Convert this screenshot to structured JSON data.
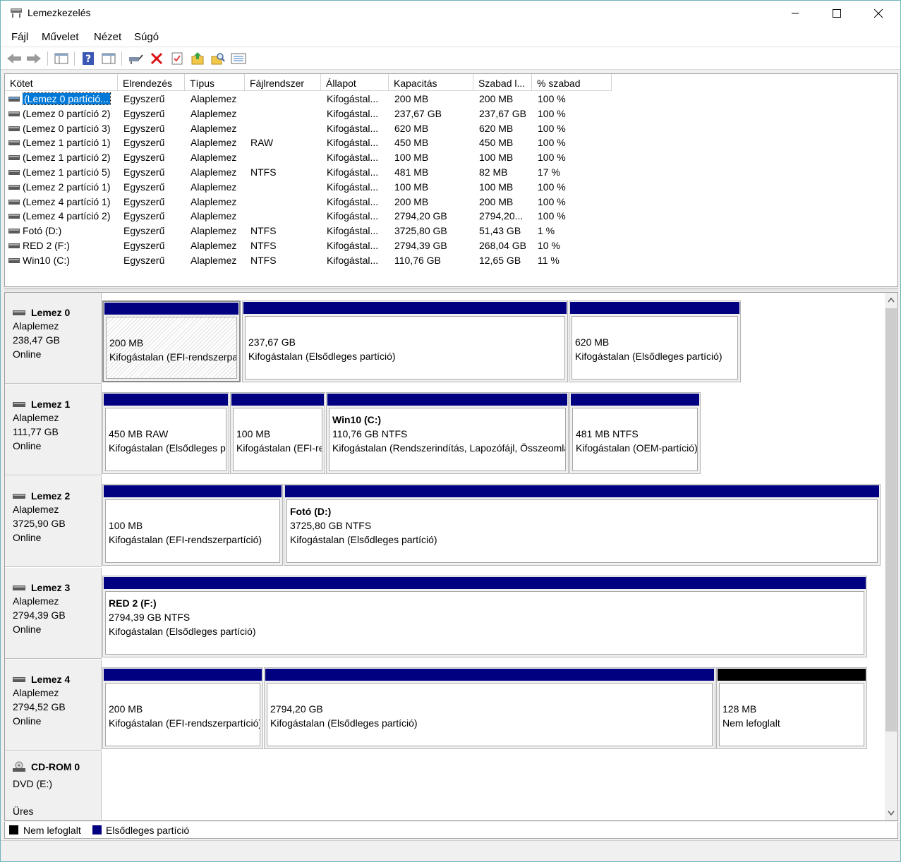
{
  "window": {
    "title": "Lemezkezelés"
  },
  "menu": [
    "Fájl",
    "Művelet",
    "Nézet",
    "Súgó"
  ],
  "toolbar": [
    "back-icon",
    "forward-icon",
    "console-tree-icon",
    "help-icon",
    "properties-view-icon",
    "connect-icon",
    "delete-icon",
    "check-icon",
    "folder-up-icon",
    "search-icon",
    "list-view-icon"
  ],
  "list": {
    "columns": [
      "Kötet",
      "Elrendezés",
      "Típus",
      "Fájlrendszer",
      "Állapot",
      "Kapacitás",
      "Szabad l...",
      "% szabad"
    ],
    "rows": [
      [
        "(Lemez 0 partíció...",
        "Egyszerű",
        "Alaplemez",
        "",
        "Kifogástal...",
        "200 MB",
        "200 MB",
        "100 %"
      ],
      [
        "(Lemez 0 partíció 2)",
        "Egyszerű",
        "Alaplemez",
        "",
        "Kifogástal...",
        "237,67 GB",
        "237,67 GB",
        "100 %"
      ],
      [
        "(Lemez 0 partíció 3)",
        "Egyszerű",
        "Alaplemez",
        "",
        "Kifogástal...",
        "620 MB",
        "620 MB",
        "100 %"
      ],
      [
        "(Lemez 1 partíció 1)",
        "Egyszerű",
        "Alaplemez",
        "RAW",
        "Kifogástal...",
        "450 MB",
        "450 MB",
        "100 %"
      ],
      [
        "(Lemez 1 partíció 2)",
        "Egyszerű",
        "Alaplemez",
        "",
        "Kifogástal...",
        "100 MB",
        "100 MB",
        "100 %"
      ],
      [
        "(Lemez 1 partíció 5)",
        "Egyszerű",
        "Alaplemez",
        "NTFS",
        "Kifogástal...",
        "481 MB",
        "82 MB",
        "17 %"
      ],
      [
        "(Lemez 2 partíció 1)",
        "Egyszerű",
        "Alaplemez",
        "",
        "Kifogástal...",
        "100 MB",
        "100 MB",
        "100 %"
      ],
      [
        "(Lemez 4 partíció 1)",
        "Egyszerű",
        "Alaplemez",
        "",
        "Kifogástal...",
        "200 MB",
        "200 MB",
        "100 %"
      ],
      [
        "(Lemez 4 partíció 2)",
        "Egyszerű",
        "Alaplemez",
        "",
        "Kifogástal...",
        "2794,20 GB",
        "2794,20...",
        "100 %"
      ],
      [
        "Fotó (D:)",
        "Egyszerű",
        "Alaplemez",
        "NTFS",
        "Kifogástal...",
        "3725,80 GB",
        "51,43 GB",
        "1 %"
      ],
      [
        "RED 2 (F:)",
        "Egyszerű",
        "Alaplemez",
        "NTFS",
        "Kifogástal...",
        "2794,39 GB",
        "268,04 GB",
        "10 %"
      ],
      [
        "Win10 (C:)",
        "Egyszerű",
        "Alaplemez",
        "NTFS",
        "Kifogástal...",
        "110,76 GB",
        "12,65 GB",
        "11 %"
      ]
    ]
  },
  "disks": [
    {
      "name": "Lemez 0",
      "type": "Alaplemez",
      "size": "238,47 GB",
      "status": "Online",
      "partitions": [
        {
          "title": "",
          "line1": "200 MB",
          "line2": "Kifogástalan (EFI-rendszerpartíció)",
          "bar": "primary",
          "selected": true
        },
        {
          "title": "",
          "line1": "237,67 GB",
          "line2": "Kifogástalan (Elsődleges partíció)",
          "bar": "primary"
        },
        {
          "title": "",
          "line1": "620 MB",
          "line2": "Kifogástalan (Elsődleges partíció)",
          "bar": "primary"
        }
      ]
    },
    {
      "name": "Lemez 1",
      "type": "Alaplemez",
      "size": "111,77 GB",
      "status": "Online",
      "partitions": [
        {
          "title": "",
          "line1": "450 MB RAW",
          "line2": "Kifogástalan (Elsődleges partíció)",
          "bar": "primary"
        },
        {
          "title": "",
          "line1": "100 MB",
          "line2": "Kifogástalan (EFI-rendszerpartíció)",
          "bar": "primary"
        },
        {
          "title": "Win10  (C:)",
          "line1": "110,76 GB NTFS",
          "line2": "Kifogástalan (Rendszerindítás, Lapozófájl, Összeomlási kiírás, Elsődleges partíció)",
          "bar": "primary"
        },
        {
          "title": "",
          "line1": "481 MB NTFS",
          "line2": "Kifogástalan (OEM-partíció)",
          "bar": "primary"
        }
      ]
    },
    {
      "name": "Lemez 2",
      "type": "Alaplemez",
      "size": "3725,90 GB",
      "status": "Online",
      "partitions": [
        {
          "title": "",
          "line1": "100 MB",
          "line2": "Kifogástalan (EFI-rendszerpartíció)",
          "bar": "primary"
        },
        {
          "title": "Fotó  (D:)",
          "line1": "3725,80 GB NTFS",
          "line2": "Kifogástalan (Elsődleges partíció)",
          "bar": "primary"
        }
      ]
    },
    {
      "name": "Lemez 3",
      "type": "Alaplemez",
      "size": "2794,39 GB",
      "status": "Online",
      "partitions": [
        {
          "title": "RED 2  (F:)",
          "line1": "2794,39 GB NTFS",
          "line2": "Kifogástalan (Elsődleges partíció)",
          "bar": "primary"
        }
      ]
    },
    {
      "name": "Lemez 4",
      "type": "Alaplemez",
      "size": "2794,52 GB",
      "status": "Online",
      "partitions": [
        {
          "title": "",
          "line1": "200 MB",
          "line2": "Kifogástalan (EFI-rendszerpartíció)",
          "bar": "primary"
        },
        {
          "title": "",
          "line1": "2794,20 GB",
          "line2": "Kifogástalan (Elsődleges partíció)",
          "bar": "primary"
        },
        {
          "title": "",
          "line1": "128 MB",
          "line2": "Nem lefoglalt",
          "bar": "unallocated"
        }
      ]
    }
  ],
  "cdrom": {
    "name": "CD-ROM 0",
    "type": "DVD (E:)",
    "status": "Üres"
  },
  "legend": [
    {
      "label": "Nem lefoglalt",
      "color": "#000000"
    },
    {
      "label": "Elsődleges partíció",
      "color": "#000080"
    }
  ]
}
